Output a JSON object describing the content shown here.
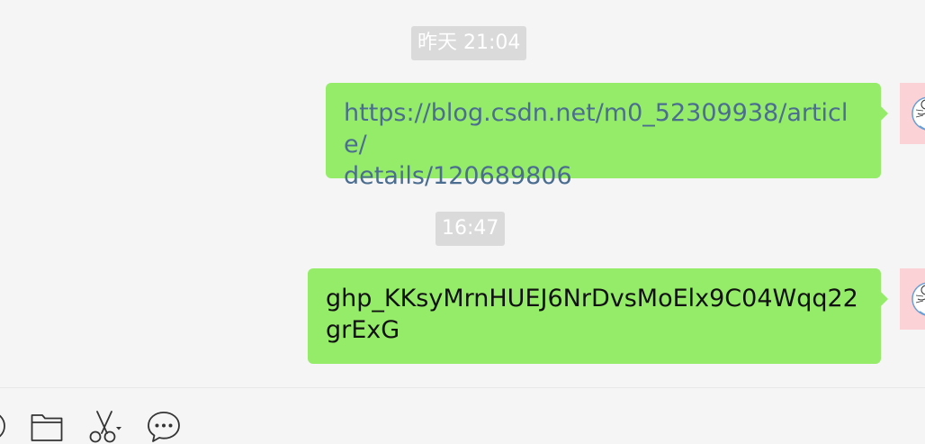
{
  "messages": [
    {
      "timestamp": "昨天 21:04",
      "text": "https://blog.csdn.net/m0_52309938/article/details/120689806",
      "line1": "https://blog.csdn.net/m0_52309938/article/",
      "line2": "details/120689806",
      "is_link": true,
      "sender": "self"
    },
    {
      "timestamp": "16:47",
      "text": "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",
      "line1": "ghp_KKsyMrnHUEJ6NrDvsMoElx9C04Wqq22",
      "line2": "grExG",
      "is_link": false,
      "sender": "self"
    }
  ],
  "toolbar": {
    "icons": [
      "emoji-icon",
      "folder-icon",
      "scissors-icon",
      "chat-bubble-icon"
    ]
  },
  "colors": {
    "chat_background": "#f5f5f5",
    "bubble_self": "#95ec69",
    "timestamp_bg": "#dadada",
    "link_text": "#4b6d8f",
    "avatar_bg": "#fbd3d6"
  }
}
